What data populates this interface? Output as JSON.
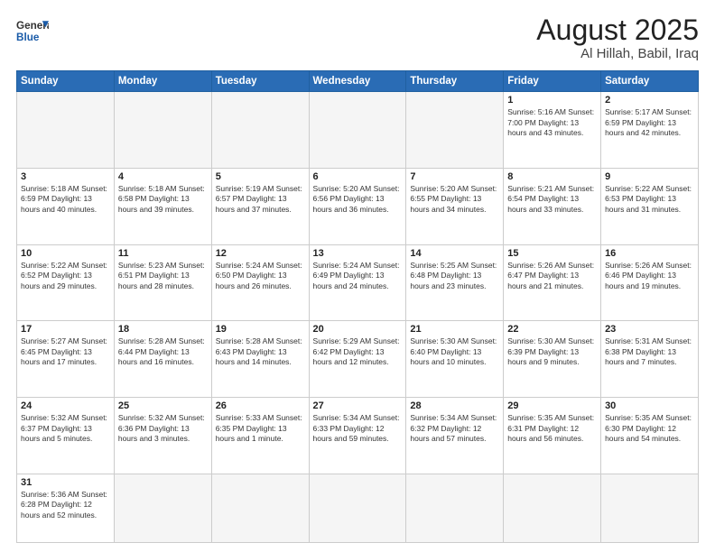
{
  "header": {
    "logo_general": "General",
    "logo_blue": "Blue",
    "title": "August 2025",
    "subtitle": "Al Hillah, Babil, Iraq"
  },
  "weekdays": [
    "Sunday",
    "Monday",
    "Tuesday",
    "Wednesday",
    "Thursday",
    "Friday",
    "Saturday"
  ],
  "weeks": [
    [
      {
        "day": "",
        "info": ""
      },
      {
        "day": "",
        "info": ""
      },
      {
        "day": "",
        "info": ""
      },
      {
        "day": "",
        "info": ""
      },
      {
        "day": "",
        "info": ""
      },
      {
        "day": "1",
        "info": "Sunrise: 5:16 AM\nSunset: 7:00 PM\nDaylight: 13 hours\nand 43 minutes."
      },
      {
        "day": "2",
        "info": "Sunrise: 5:17 AM\nSunset: 6:59 PM\nDaylight: 13 hours\nand 42 minutes."
      }
    ],
    [
      {
        "day": "3",
        "info": "Sunrise: 5:18 AM\nSunset: 6:59 PM\nDaylight: 13 hours\nand 40 minutes."
      },
      {
        "day": "4",
        "info": "Sunrise: 5:18 AM\nSunset: 6:58 PM\nDaylight: 13 hours\nand 39 minutes."
      },
      {
        "day": "5",
        "info": "Sunrise: 5:19 AM\nSunset: 6:57 PM\nDaylight: 13 hours\nand 37 minutes."
      },
      {
        "day": "6",
        "info": "Sunrise: 5:20 AM\nSunset: 6:56 PM\nDaylight: 13 hours\nand 36 minutes."
      },
      {
        "day": "7",
        "info": "Sunrise: 5:20 AM\nSunset: 6:55 PM\nDaylight: 13 hours\nand 34 minutes."
      },
      {
        "day": "8",
        "info": "Sunrise: 5:21 AM\nSunset: 6:54 PM\nDaylight: 13 hours\nand 33 minutes."
      },
      {
        "day": "9",
        "info": "Sunrise: 5:22 AM\nSunset: 6:53 PM\nDaylight: 13 hours\nand 31 minutes."
      }
    ],
    [
      {
        "day": "10",
        "info": "Sunrise: 5:22 AM\nSunset: 6:52 PM\nDaylight: 13 hours\nand 29 minutes."
      },
      {
        "day": "11",
        "info": "Sunrise: 5:23 AM\nSunset: 6:51 PM\nDaylight: 13 hours\nand 28 minutes."
      },
      {
        "day": "12",
        "info": "Sunrise: 5:24 AM\nSunset: 6:50 PM\nDaylight: 13 hours\nand 26 minutes."
      },
      {
        "day": "13",
        "info": "Sunrise: 5:24 AM\nSunset: 6:49 PM\nDaylight: 13 hours\nand 24 minutes."
      },
      {
        "day": "14",
        "info": "Sunrise: 5:25 AM\nSunset: 6:48 PM\nDaylight: 13 hours\nand 23 minutes."
      },
      {
        "day": "15",
        "info": "Sunrise: 5:26 AM\nSunset: 6:47 PM\nDaylight: 13 hours\nand 21 minutes."
      },
      {
        "day": "16",
        "info": "Sunrise: 5:26 AM\nSunset: 6:46 PM\nDaylight: 13 hours\nand 19 minutes."
      }
    ],
    [
      {
        "day": "17",
        "info": "Sunrise: 5:27 AM\nSunset: 6:45 PM\nDaylight: 13 hours\nand 17 minutes."
      },
      {
        "day": "18",
        "info": "Sunrise: 5:28 AM\nSunset: 6:44 PM\nDaylight: 13 hours\nand 16 minutes."
      },
      {
        "day": "19",
        "info": "Sunrise: 5:28 AM\nSunset: 6:43 PM\nDaylight: 13 hours\nand 14 minutes."
      },
      {
        "day": "20",
        "info": "Sunrise: 5:29 AM\nSunset: 6:42 PM\nDaylight: 13 hours\nand 12 minutes."
      },
      {
        "day": "21",
        "info": "Sunrise: 5:30 AM\nSunset: 6:40 PM\nDaylight: 13 hours\nand 10 minutes."
      },
      {
        "day": "22",
        "info": "Sunrise: 5:30 AM\nSunset: 6:39 PM\nDaylight: 13 hours\nand 9 minutes."
      },
      {
        "day": "23",
        "info": "Sunrise: 5:31 AM\nSunset: 6:38 PM\nDaylight: 13 hours\nand 7 minutes."
      }
    ],
    [
      {
        "day": "24",
        "info": "Sunrise: 5:32 AM\nSunset: 6:37 PM\nDaylight: 13 hours\nand 5 minutes."
      },
      {
        "day": "25",
        "info": "Sunrise: 5:32 AM\nSunset: 6:36 PM\nDaylight: 13 hours\nand 3 minutes."
      },
      {
        "day": "26",
        "info": "Sunrise: 5:33 AM\nSunset: 6:35 PM\nDaylight: 13 hours\nand 1 minute."
      },
      {
        "day": "27",
        "info": "Sunrise: 5:34 AM\nSunset: 6:33 PM\nDaylight: 12 hours\nand 59 minutes."
      },
      {
        "day": "28",
        "info": "Sunrise: 5:34 AM\nSunset: 6:32 PM\nDaylight: 12 hours\nand 57 minutes."
      },
      {
        "day": "29",
        "info": "Sunrise: 5:35 AM\nSunset: 6:31 PM\nDaylight: 12 hours\nand 56 minutes."
      },
      {
        "day": "30",
        "info": "Sunrise: 5:35 AM\nSunset: 6:30 PM\nDaylight: 12 hours\nand 54 minutes."
      }
    ],
    [
      {
        "day": "31",
        "info": "Sunrise: 5:36 AM\nSunset: 6:28 PM\nDaylight: 12 hours\nand 52 minutes."
      },
      {
        "day": "",
        "info": ""
      },
      {
        "day": "",
        "info": ""
      },
      {
        "day": "",
        "info": ""
      },
      {
        "day": "",
        "info": ""
      },
      {
        "day": "",
        "info": ""
      },
      {
        "day": "",
        "info": ""
      }
    ]
  ]
}
